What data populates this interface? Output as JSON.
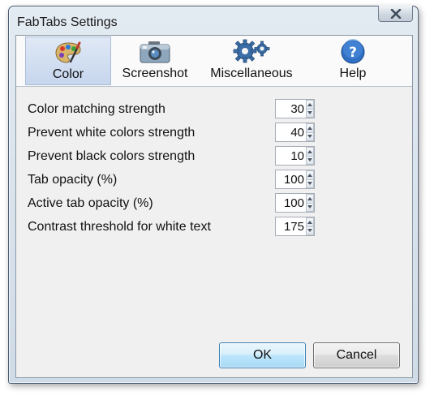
{
  "window": {
    "title": "FabTabs Settings"
  },
  "tabs": [
    {
      "label": "Color",
      "icon": "palette-icon",
      "active": true
    },
    {
      "label": "Screenshot",
      "icon": "camera-icon",
      "active": false
    },
    {
      "label": "Miscellaneous",
      "icon": "gears-icon",
      "active": false
    },
    {
      "label": "Help",
      "icon": "help-icon",
      "active": false
    }
  ],
  "settings": [
    {
      "label": "Color matching strength",
      "value": "30"
    },
    {
      "label": "Prevent white colors strength",
      "value": "40"
    },
    {
      "label": "Prevent black colors strength",
      "value": "10"
    },
    {
      "label": "Tab opacity (%)",
      "value": "100"
    },
    {
      "label": "Active tab opacity (%)",
      "value": "100"
    },
    {
      "label": "Contrast threshold for white text",
      "value": "175"
    }
  ],
  "buttons": {
    "ok": "OK",
    "cancel": "Cancel"
  },
  "colors": {
    "close_x": "#3e4b5a",
    "ok_border": "#3c7fb1",
    "tab_active": "#c7d6ee"
  }
}
